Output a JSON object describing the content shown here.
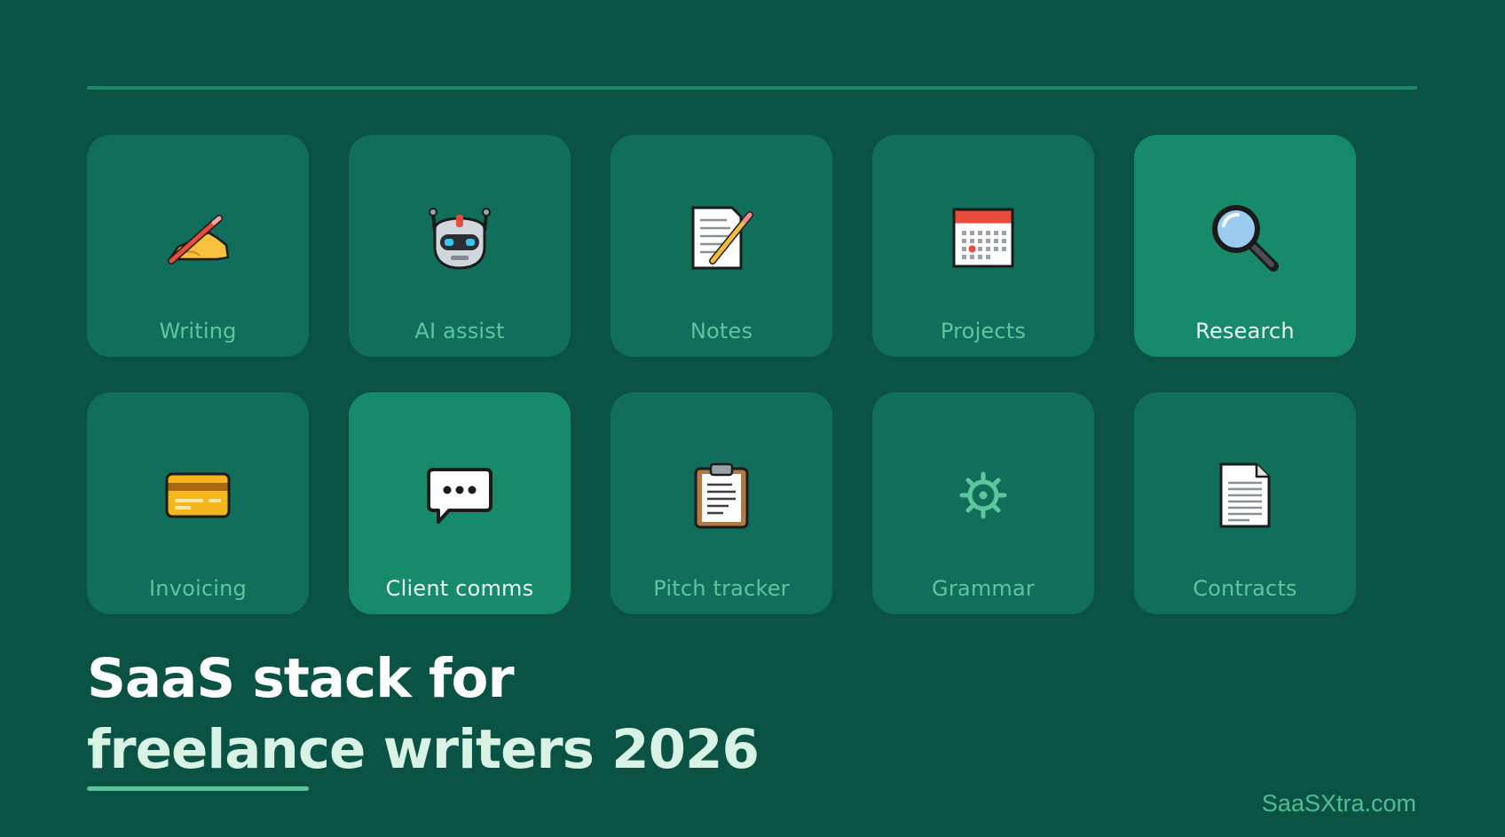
{
  "tiles": [
    {
      "label": "Writing",
      "icon": "writing-hand-icon",
      "highlight": false
    },
    {
      "label": "AI assist",
      "icon": "robot-icon",
      "highlight": false
    },
    {
      "label": "Notes",
      "icon": "memo-icon",
      "highlight": false
    },
    {
      "label": "Projects",
      "icon": "calendar-icon",
      "highlight": false
    },
    {
      "label": "Research",
      "icon": "magnifying-glass-icon",
      "highlight": true
    },
    {
      "label": "Invoicing",
      "icon": "credit-card-icon",
      "highlight": false
    },
    {
      "label": "Client comms",
      "icon": "speech-bubble-icon",
      "highlight": true
    },
    {
      "label": "Pitch tracker",
      "icon": "clipboard-icon",
      "highlight": false
    },
    {
      "label": "Grammar",
      "icon": "gear-icon",
      "highlight": false
    },
    {
      "label": "Contracts",
      "icon": "document-icon",
      "highlight": false
    }
  ],
  "headline": {
    "line1": "SaaS stack for",
    "line2": "freelance writers 2026"
  },
  "site": "SaaSXtra.com",
  "colors": {
    "background": "#0a5244",
    "tile": "#106e5a",
    "tile_highlight": "#178a69",
    "accent": "#5cc69d"
  }
}
